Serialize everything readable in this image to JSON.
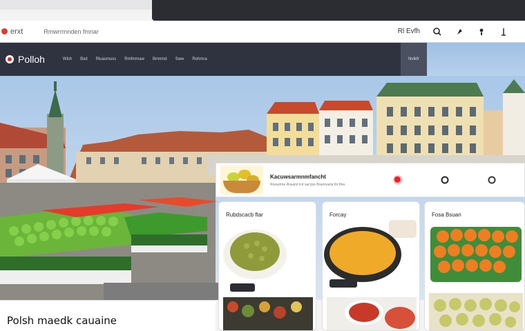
{
  "browser": {
    "brand": "erxt",
    "tab_title": "Rmwrrmnden fmnar",
    "user_label": "Rl Evfh"
  },
  "site": {
    "logo": "Polloh",
    "nav_links": [
      "Wlch",
      "Bxd",
      "Rluasmuss",
      "Rmfmmaw",
      "Bmnmd",
      "Sww",
      "Rohmra"
    ],
    "nav_side_label": "Nvtkfr"
  },
  "info_card": {
    "title": "Kacuwsarmnmfancht",
    "subtitle": "Rosaclmu Rusaml lcrt saccpe Brarnnacla fm fma"
  },
  "cards": [
    {
      "label": "Rubdscacb ftar"
    },
    {
      "label": "Forcay"
    },
    {
      "label": "Fosa Bsuan"
    }
  ],
  "caption": "Polsh maedk cauaine",
  "colors": {
    "nav_bg": "#2f3340",
    "accent_red": "#e23b2e",
    "card_bg": "#ffffff"
  },
  "icons": [
    "home-icon",
    "search-icon",
    "bookmark-icon",
    "profile-icon",
    "menu-icon",
    "logo-icon",
    "alert-icon",
    "fish-icon",
    "chat-icon"
  ]
}
